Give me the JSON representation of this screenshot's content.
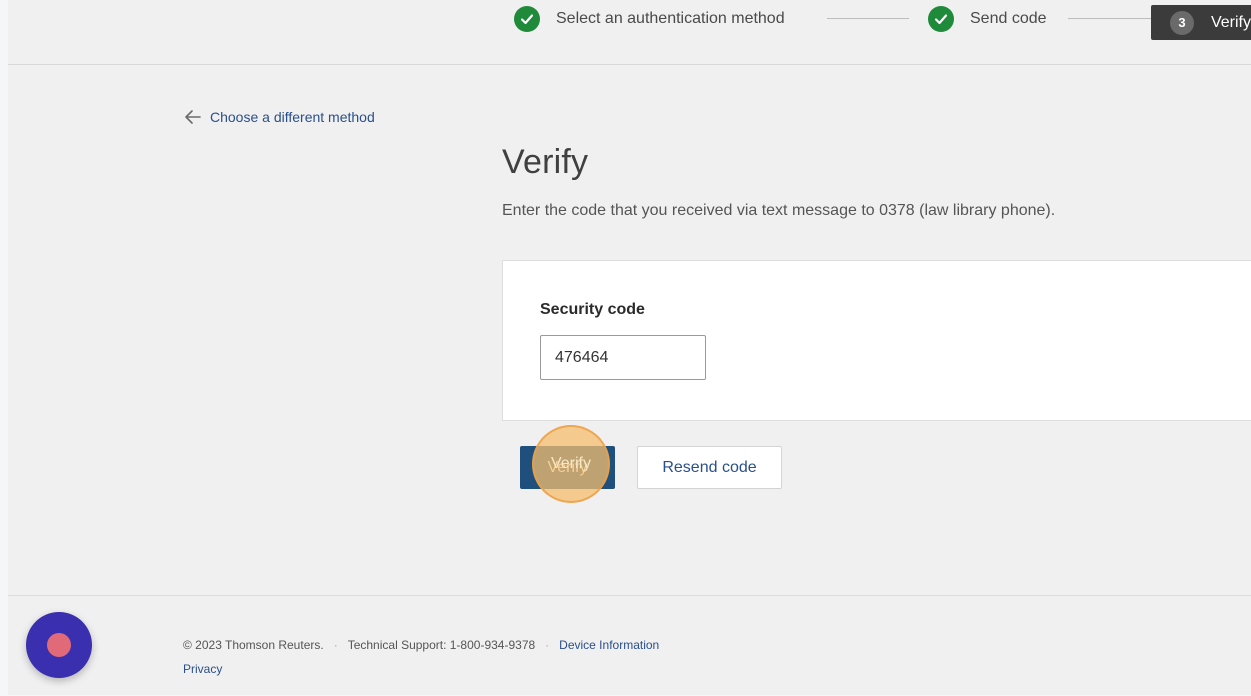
{
  "stepper": {
    "steps": [
      {
        "label": "Select an authentication method",
        "status": "complete"
      },
      {
        "label": "Send code",
        "status": "complete"
      },
      {
        "label": "Verify",
        "number": "3",
        "status": "current"
      }
    ]
  },
  "back_link": {
    "label": "Choose a different method",
    "icon": "arrow-left-icon"
  },
  "main": {
    "title": "Verify",
    "instructions": "Enter the code that you received via text message to 0378 (law library phone).",
    "security_code": {
      "label": "Security code",
      "value": "476464"
    },
    "verify_label": "Verify",
    "resend_label": "Resend code"
  },
  "footer": {
    "copyright": "© 2023 Thomson Reuters.",
    "separator": "·",
    "support": "Technical Support: 1-800-934-9378",
    "device_info": "Device Information",
    "privacy": "Privacy"
  },
  "colors": {
    "success": "#1e8a3a",
    "primary_button": "#1f4f7c",
    "link": "#2a4f8a",
    "chat_button": "#3a2fae"
  }
}
